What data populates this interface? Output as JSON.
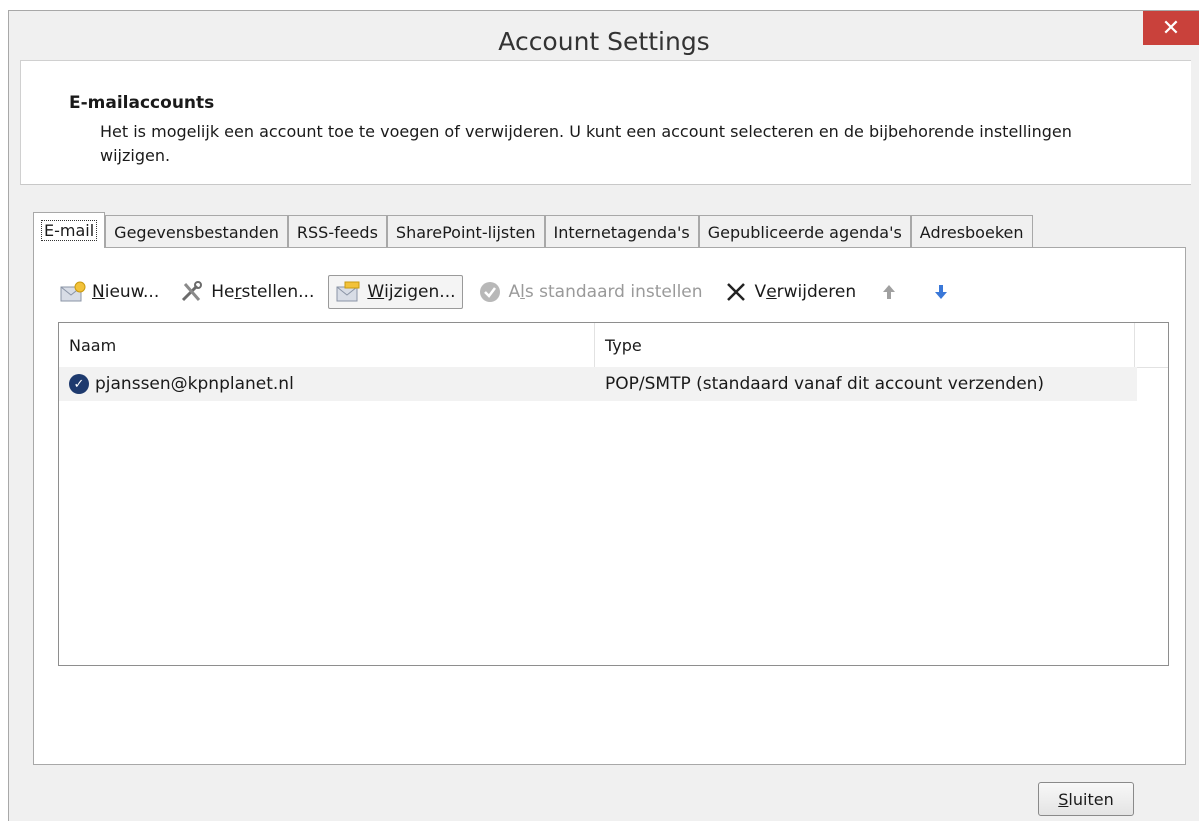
{
  "window": {
    "title": "Account Settings",
    "close_glyph": "✕"
  },
  "header": {
    "title": "E-mailaccounts",
    "description": "Het is mogelijk een account toe te voegen of verwijderen. U kunt een account selecteren en de bijbehorende instellingen wijzigen."
  },
  "tabs": [
    {
      "label": "E-mail",
      "active": true
    },
    {
      "label": "Gegevensbestanden"
    },
    {
      "label": "RSS-feeds"
    },
    {
      "label": "SharePoint-lijsten"
    },
    {
      "label": "Internetagenda's"
    },
    {
      "label": "Gepubliceerde agenda's"
    },
    {
      "label": "Adresboeken"
    }
  ],
  "toolbar": {
    "new": {
      "pre": "",
      "key": "N",
      "post": "ieuw...",
      "icon": "new-account-icon"
    },
    "repair": {
      "pre": "He",
      "key": "r",
      "post": "stellen...",
      "icon": "repair-tools-icon"
    },
    "change": {
      "pre": "",
      "key": "W",
      "post": "ijzigen...",
      "icon": "change-account-icon"
    },
    "set_default": {
      "pre": "A",
      "key": "l",
      "post": "s standaard instellen",
      "icon": "checkmark-circle-icon"
    },
    "remove": {
      "pre": "V",
      "key": "e",
      "post": "rwijderen",
      "icon": "delete-x-icon"
    },
    "move_up_icon": "arrow-up-icon",
    "move_down_icon": "arrow-down-icon"
  },
  "list": {
    "columns": [
      "Naam",
      "Type"
    ],
    "rows": [
      {
        "name": "pjanssen@kpnplanet.nl",
        "type": "POP/SMTP (standaard vanaf dit account verzenden)",
        "icon": "default-account-check-icon"
      }
    ]
  },
  "footer": {
    "close": {
      "pre": "",
      "key": "S",
      "post": "luiten"
    }
  },
  "colors": {
    "close_button": "#c9413b",
    "window_bg": "#f0f0f0",
    "selected_row": "#f2f2f2",
    "arrow_down": "#3a78d8",
    "arrow_up": "#a0a0a0"
  }
}
